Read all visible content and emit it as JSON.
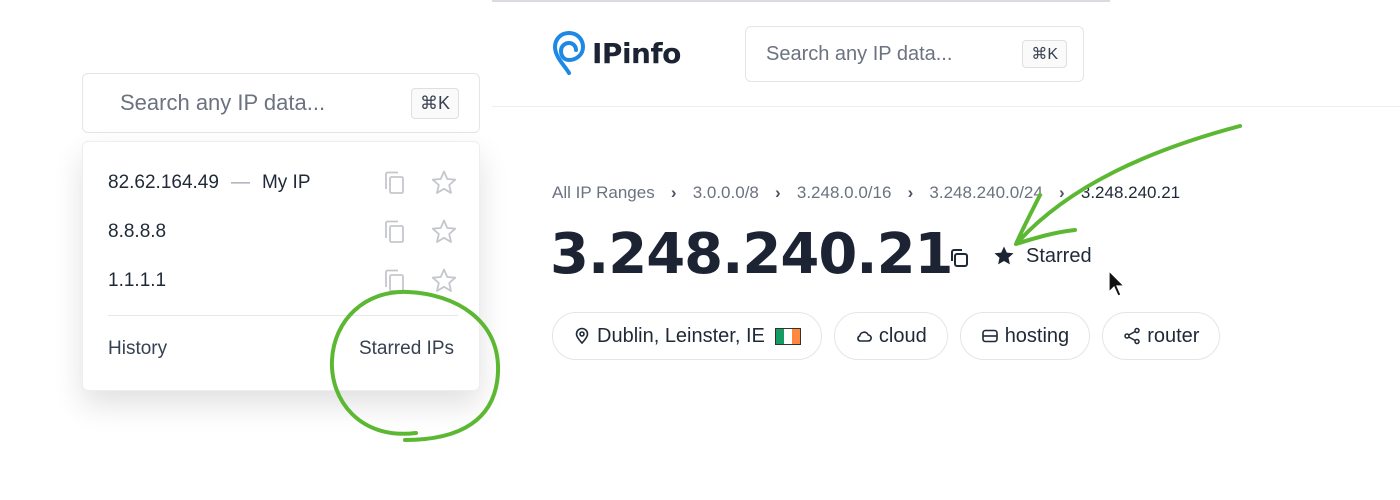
{
  "header": {
    "logo_text": "IPinfo",
    "search_placeholder": "Search any IP data...",
    "shortcut": "⌘K"
  },
  "breadcrumb": {
    "items": [
      "All IP Ranges",
      "3.0.0.0/8",
      "3.248.0.0/16",
      "3.248.240.0/24",
      "3.248.240.21"
    ]
  },
  "ip_title": "3.248.240.21",
  "star": {
    "label": "Starred",
    "state": "starred"
  },
  "tags": [
    {
      "icon": "location-pin-icon",
      "label": "Dublin, Leinster, IE"
    },
    {
      "icon": "cloud-icon",
      "label": "cloud"
    },
    {
      "icon": "server-icon",
      "label": "hosting"
    },
    {
      "icon": "share-nodes-icon",
      "label": "router"
    }
  ],
  "dropdown": {
    "search_placeholder": "Search any IP data...",
    "shortcut": "⌘K",
    "items": [
      {
        "ip": "82.62.164.49",
        "dash": "—",
        "note": "My IP"
      },
      {
        "ip": "8.8.8.8",
        "dash": "",
        "note": ""
      },
      {
        "ip": "1.1.1.1",
        "dash": "",
        "note": ""
      }
    ],
    "history_label": "History",
    "starred_label": "Starred IPs"
  },
  "colors": {
    "brand_blue": "#1e88e5",
    "text_dark": "#1c2434",
    "annotation_green": "#5cb833",
    "icon_gray": "#c4c7cc",
    "flag_green": "#169b62",
    "flag_orange": "#ff883e"
  }
}
